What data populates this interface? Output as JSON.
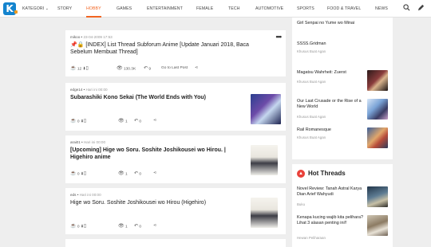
{
  "nav": {
    "categories": "KATEGORI",
    "items": [
      "STORY",
      "HOBBY",
      "GAMES",
      "ENTERTAINMENT",
      "FEMALE",
      "TECH",
      "AUTOMOTIVE",
      "SPORTS",
      "FOOD & TRAVEL",
      "NEWS"
    ],
    "active": "HOBBY"
  },
  "threads": [
    {
      "author": "mikoo",
      "date": "23-04-2009 17:53",
      "title": "[INDEX] List Thread Subforum Anime [Update Januari 2018, Baca Sebelum Membuat Thread]",
      "votes": "12",
      "views": "130.3K",
      "replies": "9",
      "last_post": "Go to Last Post"
    },
    {
      "author": "edge14",
      "date": "Hari ini 00:00",
      "title": "Subarashiki Kono Sekai (The World Ends with You)",
      "votes": "0",
      "views": "1",
      "replies": "0"
    },
    {
      "author": "arai01",
      "date": "Hari ini 00:00",
      "title": "[Upcoming] Hige wo Soru. Soshite Joshikousei wo Hirou. | Higehiro anime",
      "votes": "0",
      "views": "1",
      "replies": "0"
    },
    {
      "author": "eds",
      "date": "Hari ini 00:00",
      "title": "Hige wo Soru. Soshite Joshikousei wo Hirou (Higehiro)",
      "votes": "0",
      "views": "1",
      "replies": "0"
    }
  ],
  "sidebar": {
    "items": [
      {
        "title": "Girl Senpai no Yume wo Minai",
        "sub": "Khusus Buat Agan"
      },
      {
        "title": "SSSS.Gridman",
        "sub": "Khusus Buat Agan"
      },
      {
        "title": "Magatsu Wahrheit: Zuerst",
        "sub": "Khusus Buat Agan"
      },
      {
        "title": "Our Last Crusade or the Rise of a New World",
        "sub": "Khusus Buat Agan"
      },
      {
        "title": "Rail Romanesque",
        "sub": "Khusus Buat Agan"
      }
    ],
    "hot_title": "Hot Threads",
    "hot": [
      {
        "title": "Novel Review: Tanah Astral Karya Dian Arief Wahyudi",
        "sub": "Buku"
      },
      {
        "title": "Kenapa kucing wajib kita pelihara? Lihat 3 alasan penting ini!!",
        "sub": "Hewan Peliharaan"
      }
    ]
  },
  "colors": {
    "accent": "#f26522",
    "logo": "#1484ce",
    "hot": "#e9413a"
  }
}
